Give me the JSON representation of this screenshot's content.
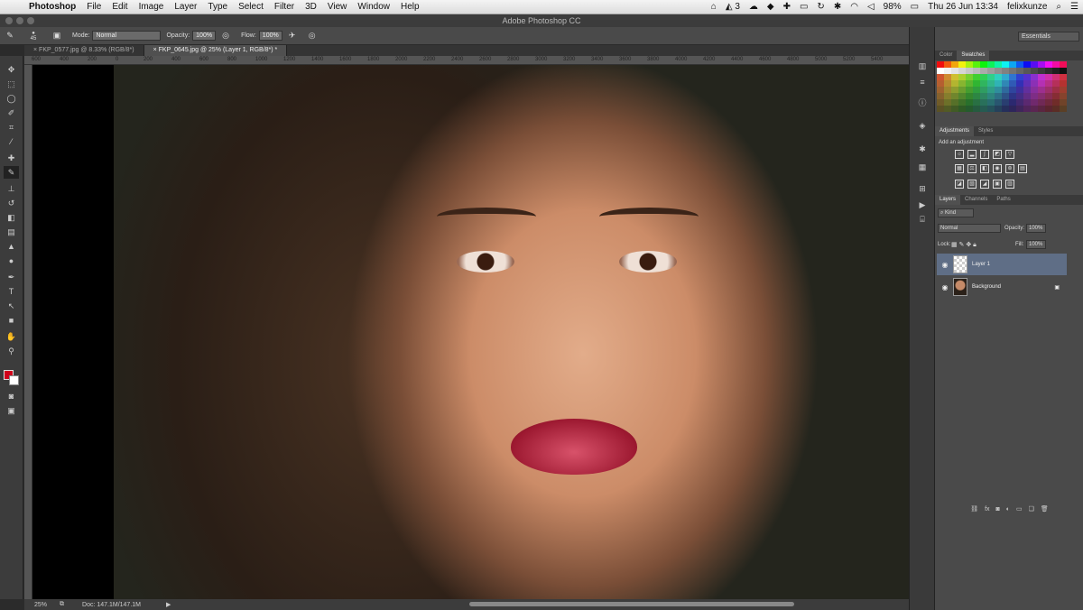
{
  "menubar": {
    "app_name": "Photoshop",
    "menus": [
      "File",
      "Edit",
      "Image",
      "Layer",
      "Type",
      "Select",
      "Filter",
      "3D",
      "View",
      "Window",
      "Help"
    ],
    "status": {
      "ai": "3",
      "battery": "98%",
      "datetime": "Thu 26 Jun  13:34",
      "user": "felixkunze"
    }
  },
  "window": {
    "title": "Adobe Photoshop CC"
  },
  "options": {
    "brush_size": "45",
    "mode_label": "Mode:",
    "mode_value": "Normal",
    "opacity_label": "Opacity:",
    "opacity_value": "100%",
    "flow_label": "Flow:",
    "flow_value": "100%"
  },
  "tabs": [
    {
      "label": "FKP_0577.jpg @ 8.33% (RGB/8*)"
    },
    {
      "label": "FKP_0645.jpg @ 25% (Layer 1, RGB/8*) *"
    }
  ],
  "ruler_ticks": [
    "600",
    "400",
    "200",
    "0",
    "200",
    "400",
    "600",
    "800",
    "1000",
    "1200",
    "1400",
    "1600",
    "1800",
    "2000",
    "2200",
    "2400",
    "2600",
    "2800",
    "3000",
    "3200",
    "3400",
    "3600",
    "3800",
    "4000",
    "4200",
    "4400",
    "4600",
    "4800",
    "5000",
    "5200",
    "5400"
  ],
  "status": {
    "zoom": "25%",
    "doc": "Doc: 147.1M/147.1M"
  },
  "workspace": "Essentials",
  "panels": {
    "color_tabs": [
      "Color",
      "Swatches"
    ],
    "adjust_tabs": [
      "Adjustments",
      "Styles"
    ],
    "add_adjustment": "Add an adjustment",
    "layer_tabs": [
      "Layers",
      "Channels",
      "Paths"
    ],
    "kind": "Kind",
    "blend": "Normal",
    "opacity_label": "Opacity:",
    "opacity_value": "100%",
    "lock_label": "Lock:",
    "fill_label": "Fill:",
    "fill_value": "100%"
  },
  "layers": [
    {
      "name": "Layer 1",
      "selected": true
    },
    {
      "name": "Background",
      "selected": false
    }
  ],
  "colors": {
    "foreground": "#d0021b",
    "background": "#ffffff",
    "selection": "#5f6e86"
  }
}
